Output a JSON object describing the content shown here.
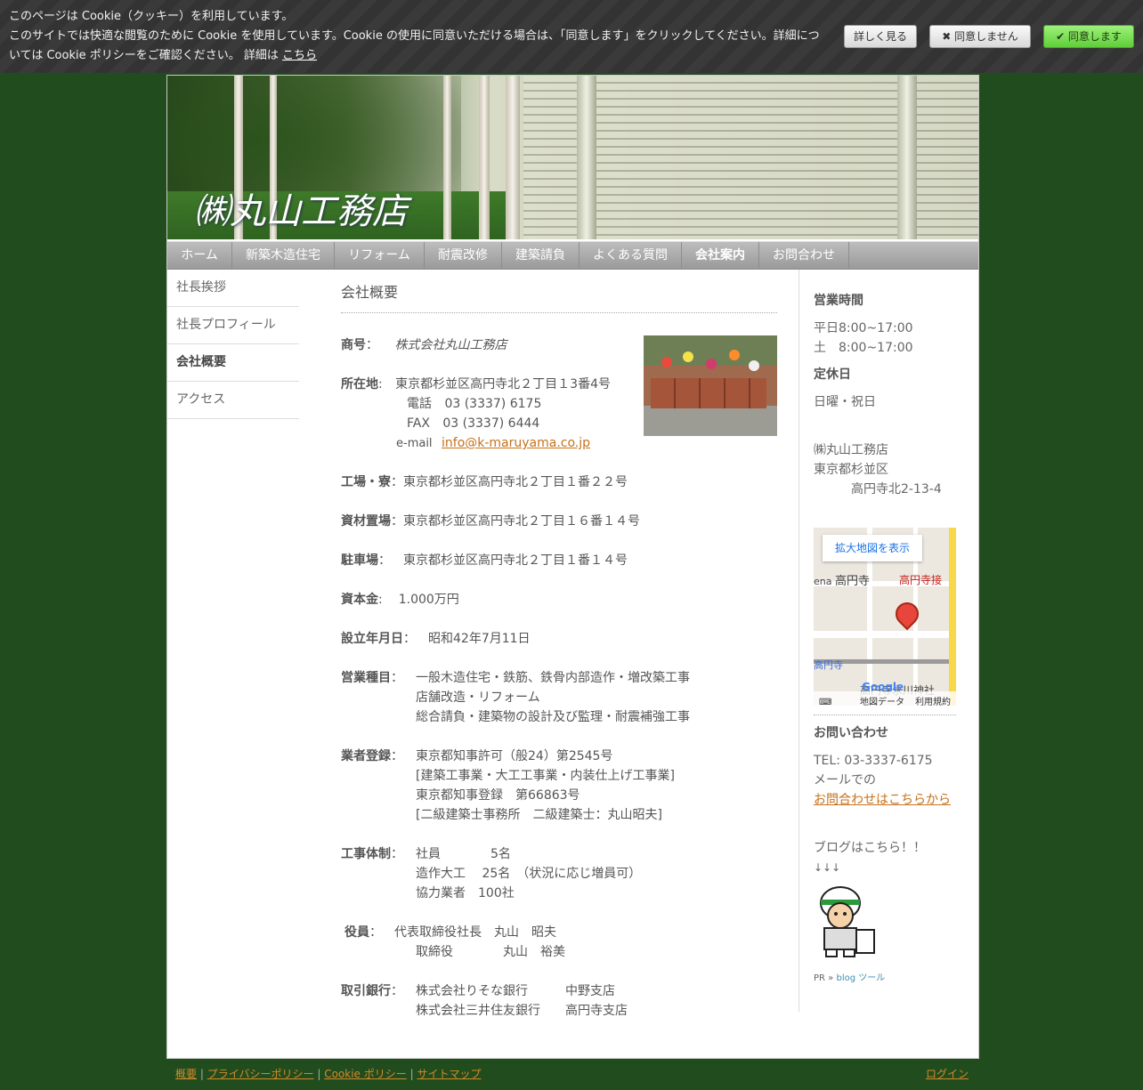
{
  "cookie": {
    "line1": "このページは Cookie（クッキー）を利用しています。",
    "line2": "このサイトでは快適な閲覧のために Cookie を使用しています。Cookie の使用に同意いただける場合は、「同意します」をクリックしてください。詳細につ",
    "line3": "いては Cookie ポリシーをご確認ください。 詳細は ",
    "link": "こちら",
    "more_label": "詳しく見る",
    "deny_label": "✖ 同意しません",
    "accept_label": "✔ 同意します"
  },
  "site": {
    "title": "㈱丸山工務店"
  },
  "nav": [
    "ホーム",
    "新築木造住宅",
    "リフォーム",
    "耐震改修",
    "建築請負",
    "よくある質問",
    "会社案内",
    "お問合わせ"
  ],
  "submenu": [
    "社長挨拶",
    "社長プロフィール",
    "会社概要",
    "アクセス"
  ],
  "content": {
    "heading": "会社概要",
    "shogo_label": "商号",
    "shogo_value": "株式会社丸山工務店",
    "addr_label": "所在地",
    "addr_value": "東京都杉並区高円寺北２丁目１3番4号",
    "tel_label": "電話",
    "tel_value": "03 (3337) 6175",
    "fax_label": "FAX",
    "fax_value": "03 (3337) 6444",
    "email_label": "e-mail",
    "email_value": "info@k-maruyama.co.jp",
    "factory_label": "工場・寮",
    "factory_value": "東京都杉並区高円寺北２丁目１番２２号",
    "storage_label": "資材置場",
    "storage_value": "東京都杉並区高円寺北２丁目１６番１４号",
    "parking_label": "駐車場",
    "parking_value": "東京都杉並区高円寺北２丁目１番１４号",
    "capital_label": "資本金",
    "capital_value": "1.000万円",
    "founded_label": "設立年月日",
    "founded_value": "昭和42年7月11日",
    "business_label": "営業種目",
    "business_lines": [
      "一般木造住宅・鉄筋、鉄骨内部造作・増改築工事",
      "店舗改造・リフォーム",
      "総合請負・建築物の設計及び監理・耐震補強工事"
    ],
    "reg_label": "業者登録",
    "reg_lines": [
      "東京都知事許可（般24）第2545号",
      "[建築工事業・大工工事業・内装仕上げ工事業]",
      "東京都知事登録　第66863号",
      "[二級建築士事務所　二級建築士：丸山昭夫]"
    ],
    "staff_label": "工事体制",
    "staff_lines": [
      "社員　　　　5名",
      "造作大工　 25名　（状況に応じ増員可）",
      "協力業者　100社"
    ],
    "officer_label": "役員",
    "officer_lines": [
      "代表取締役社長　丸山　昭夫",
      "取締役　　　　丸山　裕美"
    ],
    "bank_label": "取引銀行",
    "bank_lines": [
      "株式会社りそな銀行　　　中野支店",
      "株式会社三井住友銀行　　高円寺支店"
    ]
  },
  "sidebar": {
    "hours_title": "営業時間",
    "hours_lines": [
      "平日8:00~17:00",
      "土　8:00~17:00"
    ],
    "closed_title": "定休日",
    "closed_value": "日曜・祝日",
    "company": "㈱丸山工務店",
    "addr1": "東京都杉並区",
    "addr2": "高円寺北2-13-4",
    "map_link": "拡大地図を表示",
    "map_labels": [
      "高円寺",
      "高円寺接",
      "高円寺",
      "高円寺氷川神社",
      "ena"
    ],
    "map_footer": [
      "地図データ",
      "利用規約"
    ],
    "map_logo": "Google",
    "contact_title": "お問い合わせ",
    "contact_tel": "TEL: 03-3337-6175",
    "contact_mail": "メールでの",
    "contact_link": "お問合わせはこちらから",
    "blog_text": "ブログはこちら！！",
    "blog_arrows": "↓↓↓",
    "pr_text": "PR » ",
    "pr_link": "blog ツール"
  },
  "footer": {
    "links": [
      "概要",
      "プライバシーポリシー",
      "Cookie ポリシー",
      "サイトマップ"
    ],
    "login": "ログイン"
  }
}
